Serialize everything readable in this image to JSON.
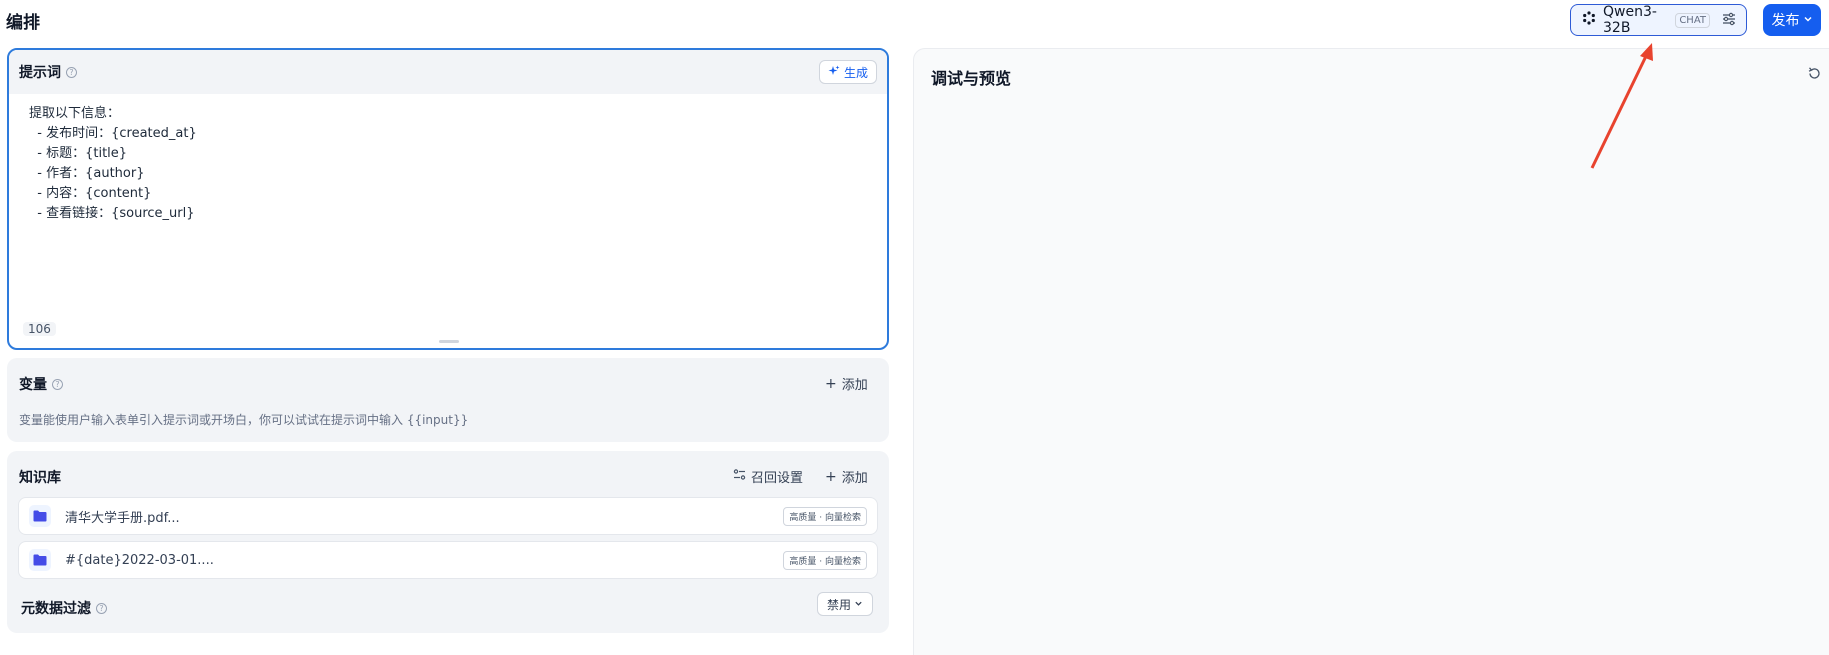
{
  "header": {
    "title": "编排",
    "model": {
      "name": "Qwen3-32B",
      "tag": "CHAT",
      "icon": "model-provider-icon",
      "settings_icon": "sliders-icon"
    },
    "publish_label": "发布"
  },
  "prompt": {
    "title": "提示词",
    "generate_label": "生成",
    "text": "提取以下信息：\n  - 发布时间：{created_at}\n  - 标题：{title}\n  - 作者：{author}\n  - 内容：{content}\n  - 查看链接：{source_url}",
    "char_count": "106"
  },
  "variables": {
    "title": "变量",
    "add_label": "添加",
    "description": "变量能使用户输入表单引入提示词或开场白，你可以试试在提示词中输入 {{input}}"
  },
  "knowledge": {
    "title": "知识库",
    "recall_label": "召回设置",
    "add_label": "添加",
    "items": [
      {
        "name": "清华大学手册.pdf...",
        "tag": "高质量 · 向量检索"
      },
      {
        "name": "#{date}2022-03-01....",
        "tag": "高质量 · 向量检索"
      }
    ],
    "metadata_filter": {
      "title": "元数据过滤",
      "value": "禁用"
    }
  },
  "debug": {
    "title": "调试与预览"
  },
  "colors": {
    "accent": "#155eef",
    "annotation": "#e8432e"
  }
}
